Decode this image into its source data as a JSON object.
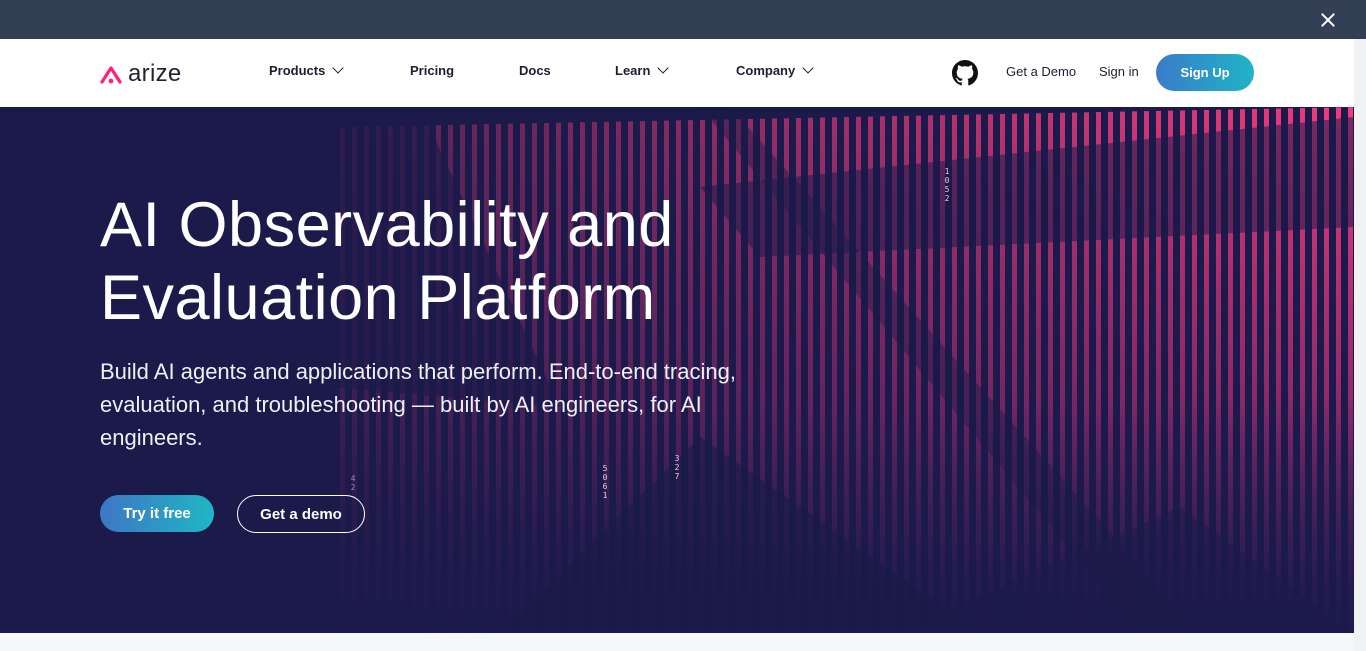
{
  "banner": {
    "close_icon": "close-icon"
  },
  "nav": {
    "logo_text": "arize",
    "items": [
      {
        "label": "Products",
        "has_dropdown": true
      },
      {
        "label": "Pricing",
        "has_dropdown": false
      },
      {
        "label": "Docs",
        "has_dropdown": false
      },
      {
        "label": "Learn",
        "has_dropdown": true
      },
      {
        "label": "Company",
        "has_dropdown": true
      }
    ],
    "github_icon": "github-icon",
    "get_demo": "Get a Demo",
    "sign_in": "Sign in",
    "sign_up": "Sign Up"
  },
  "hero": {
    "title_line1": "AI Observability and",
    "title_line2": "Evaluation Platform",
    "subtitle": "Build AI agents and applications that perform. End-to-end tracing, evaluation, and troubleshooting — built by AI engineers, for AI engineers.",
    "try_free": "Try it free",
    "get_demo": "Get a demo",
    "digits": [
      "1052",
      "5061",
      "327",
      "42"
    ]
  },
  "colors": {
    "topbar": "#333f54",
    "hero_bg": "#1b1a4a",
    "accent_pink": "#ff2f7a",
    "accent_blue": "#3a7bc8",
    "accent_teal": "#20b4c6"
  }
}
